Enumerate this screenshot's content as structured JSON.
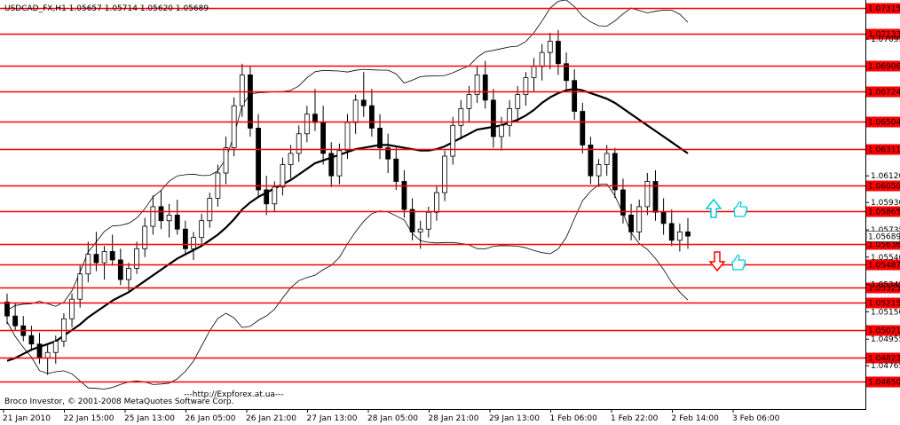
{
  "chart_data": {
    "type": "candlestick",
    "symbol_header": "USDCAD_FX,H1  1.05657 1.05714 1.05620 1.05689",
    "copyright": "Broco Investor, © 2001-2008 MetaQuotes Software Corp.",
    "watermark": "---http://Expforex.at.ua---",
    "ylim": [
      1.04545,
      1.0733
    ],
    "x_ticks": [
      "21 Jan 2010",
      "22 Jan 15:00",
      "25 Jan 13:00",
      "26 Jan 05:00",
      "26 Jan 21:00",
      "27 Jan 13:00",
      "28 Jan 05:00",
      "28 Jan 21:00",
      "29 Jan 13:00",
      "1 Feb 06:00",
      "1 Feb 22:00",
      "2 Feb 14:00",
      "3 Feb 06:00"
    ],
    "y_ticks": [
      "1.07095",
      "1.06120",
      "1.05930",
      "1.05735",
      "1.05540",
      "1.05345",
      "1.05150",
      "1.04955",
      "1.04765"
    ],
    "levels": [
      {
        "label": "1.07315",
        "value": 1.07315
      },
      {
        "label": "1.07133",
        "value": 1.07133
      },
      {
        "label": "1.06906",
        "value": 1.06906
      },
      {
        "label": "1.06724",
        "value": 1.06724
      },
      {
        "label": "1.06504",
        "value": 1.06504
      },
      {
        "label": "1.06311",
        "value": 1.06311
      },
      {
        "label": "1.06050",
        "value": 1.0605
      },
      {
        "label": "1.05865",
        "value": 1.05865
      },
      {
        "label": "1.05636",
        "value": 1.05636
      },
      {
        "label": "1.05487",
        "value": 1.05487
      },
      {
        "label": "1.05325",
        "value": 1.05325
      },
      {
        "label": "1.05215",
        "value": 1.05215
      },
      {
        "label": "1.05021",
        "value": 1.05021
      },
      {
        "label": "1.04823",
        "value": 1.04823
      },
      {
        "label": "1.04650",
        "value": 1.0465
      }
    ],
    "current_price": "1.05689",
    "colors": {
      "level_line": "#ff0000",
      "level_label_bg": "#ff0000",
      "level_label_text": "#ffffff",
      "candle": "#000000",
      "arrow_up": "#00ccdd",
      "arrow_down": "#ff0000",
      "hand_icon": "#00ccdd"
    },
    "signals": [
      {
        "type": "buy",
        "icon": "arrow-up",
        "hand": "thumbs-up-hand"
      },
      {
        "type": "sell",
        "icon": "arrow-down",
        "hand": "thumbs-up-hand"
      }
    ],
    "candles": [
      [
        1.0522,
        1.0528,
        1.0506,
        1.0512
      ],
      [
        1.0512,
        1.0521,
        1.0502,
        1.0505
      ],
      [
        1.0505,
        1.0512,
        1.0494,
        1.0498
      ],
      [
        1.0498,
        1.0505,
        1.0487,
        1.0492
      ],
      [
        1.0492,
        1.05,
        1.0478,
        1.0482
      ],
      [
        1.0482,
        1.0492,
        1.047,
        1.0486
      ],
      [
        1.0486,
        1.0498,
        1.0478,
        1.0494
      ],
      [
        1.0494,
        1.0514,
        1.049,
        1.051
      ],
      [
        1.051,
        1.0528,
        1.0504,
        1.0524
      ],
      [
        1.0524,
        1.0548,
        1.0518,
        1.0542
      ],
      [
        1.0542,
        1.0565,
        1.0536,
        1.0556
      ],
      [
        1.0556,
        1.0572,
        1.0544,
        1.055
      ],
      [
        1.055,
        1.0562,
        1.0538,
        1.0558
      ],
      [
        1.0558,
        1.057,
        1.0548,
        1.0552
      ],
      [
        1.0552,
        1.056,
        1.0534,
        1.0538
      ],
      [
        1.0538,
        1.055,
        1.053,
        1.0546
      ],
      [
        1.0546,
        1.0565,
        1.0542,
        1.056
      ],
      [
        1.056,
        1.0582,
        1.0554,
        1.0576
      ],
      [
        1.0576,
        1.0598,
        1.057,
        1.059
      ],
      [
        1.059,
        1.0602,
        1.0574,
        1.058
      ],
      [
        1.058,
        1.0592,
        1.0568,
        1.0584
      ],
      [
        1.0584,
        1.0595,
        1.057,
        1.0574
      ],
      [
        1.0574,
        1.058,
        1.0556,
        1.056
      ],
      [
        1.056,
        1.0572,
        1.0552,
        1.0568
      ],
      [
        1.0568,
        1.0585,
        1.0562,
        1.058
      ],
      [
        1.058,
        1.06,
        1.0575,
        1.0596
      ],
      [
        1.0596,
        1.062,
        1.059,
        1.0614
      ],
      [
        1.0614,
        1.064,
        1.0606,
        1.0632
      ],
      [
        1.0632,
        1.0668,
        1.0626,
        1.0662
      ],
      [
        1.0662,
        1.0692,
        1.0654,
        1.0684
      ],
      [
        1.0684,
        1.069,
        1.064,
        1.0646
      ],
      [
        1.0646,
        1.0656,
        1.0596,
        1.0602
      ],
      [
        1.0602,
        1.0612,
        1.0584,
        1.0592
      ],
      [
        1.0592,
        1.0608,
        1.0586,
        1.0604
      ],
      [
        1.0604,
        1.0625,
        1.0598,
        1.062
      ],
      [
        1.062,
        1.0634,
        1.061,
        1.0628
      ],
      [
        1.0628,
        1.0648,
        1.0622,
        1.0642
      ],
      [
        1.0642,
        1.0662,
        1.0636,
        1.0656
      ],
      [
        1.0656,
        1.0674,
        1.0644,
        1.065
      ],
      [
        1.065,
        1.0662,
        1.062,
        1.0628
      ],
      [
        1.0628,
        1.0636,
        1.0604,
        1.0612
      ],
      [
        1.0612,
        1.0635,
        1.0606,
        1.063
      ],
      [
        1.063,
        1.0656,
        1.0624,
        1.065
      ],
      [
        1.065,
        1.067,
        1.0642,
        1.0666
      ],
      [
        1.0666,
        1.0686,
        1.0654,
        1.0662
      ],
      [
        1.0662,
        1.0674,
        1.064,
        1.0646
      ],
      [
        1.0646,
        1.0656,
        1.0624,
        1.0632
      ],
      [
        1.0632,
        1.0642,
        1.0614,
        1.0624
      ],
      [
        1.0624,
        1.0632,
        1.0602,
        1.0608
      ],
      [
        1.0608,
        1.0616,
        1.0582,
        1.0588
      ],
      [
        1.0588,
        1.0596,
        1.0566,
        1.0572
      ],
      [
        1.0572,
        1.058,
        1.056,
        1.0574
      ],
      [
        1.0574,
        1.059,
        1.0568,
        1.0586
      ],
      [
        1.0586,
        1.0605,
        1.058,
        1.06
      ],
      [
        1.06,
        1.063,
        1.0594,
        1.0626
      ],
      [
        1.0626,
        1.0654,
        1.062,
        1.0648
      ],
      [
        1.0648,
        1.0666,
        1.0638,
        1.066
      ],
      [
        1.066,
        1.0676,
        1.065,
        1.067
      ],
      [
        1.067,
        1.069,
        1.0664,
        1.0684
      ],
      [
        1.0684,
        1.0694,
        1.066,
        1.0666
      ],
      [
        1.0666,
        1.0674,
        1.0632,
        1.064
      ],
      [
        1.064,
        1.0654,
        1.063,
        1.0648
      ],
      [
        1.0648,
        1.0666,
        1.064,
        1.066
      ],
      [
        1.066,
        1.0676,
        1.065,
        1.067
      ],
      [
        1.067,
        1.0686,
        1.0662,
        1.0682
      ],
      [
        1.0682,
        1.0696,
        1.0672,
        1.069
      ],
      [
        1.069,
        1.0706,
        1.068,
        1.07
      ],
      [
        1.07,
        1.0714,
        1.0688,
        1.0708
      ],
      [
        1.0708,
        1.0716,
        1.0684,
        1.0692
      ],
      [
        1.0692,
        1.07,
        1.0672,
        1.068
      ],
      [
        1.068,
        1.0688,
        1.0652,
        1.0658
      ],
      [
        1.0658,
        1.0664,
        1.0628,
        1.0634
      ],
      [
        1.0634,
        1.064,
        1.0606,
        1.0612
      ],
      [
        1.0612,
        1.0624,
        1.0604,
        1.062
      ],
      [
        1.062,
        1.0634,
        1.0612,
        1.0628
      ],
      [
        1.0628,
        1.0632,
        1.0596,
        1.0602
      ],
      [
        1.0602,
        1.061,
        1.0578,
        1.0584
      ],
      [
        1.0584,
        1.0592,
        1.0566,
        1.0572
      ],
      [
        1.0572,
        1.0595,
        1.0566,
        1.059
      ],
      [
        1.059,
        1.0614,
        1.0584,
        1.0608
      ],
      [
        1.0608,
        1.0616,
        1.058,
        1.0586
      ],
      [
        1.0586,
        1.0596,
        1.057,
        1.0578
      ],
      [
        1.0578,
        1.0588,
        1.0562,
        1.0566
      ],
      [
        1.0566,
        1.0578,
        1.0558,
        1.0572
      ],
      [
        1.0572,
        1.0582,
        1.056,
        1.0569
      ]
    ],
    "sma": [
      1.048,
      1.0482,
      1.0485,
      1.0488,
      1.049,
      1.0492,
      1.0494,
      1.0498,
      1.0502,
      1.0506,
      1.0511,
      1.0515,
      1.0519,
      1.0523,
      1.0526,
      1.0529,
      1.0533,
      1.0537,
      1.0541,
      1.0545,
      1.0549,
      1.0553,
      1.0556,
      1.0559,
      1.0562,
      1.0566,
      1.057,
      1.0575,
      1.0581,
      1.0588,
      1.0593,
      1.0597,
      1.06,
      1.0603,
      1.0606,
      1.0609,
      1.0613,
      1.0617,
      1.0621,
      1.0623,
      1.0625,
      1.0627,
      1.0629,
      1.0631,
      1.0632,
      1.0633,
      1.0634,
      1.0634,
      1.0633,
      1.0632,
      1.0631,
      1.063,
      1.063,
      1.0631,
      1.0633,
      1.0636,
      1.0639,
      1.0642,
      1.0645,
      1.0646,
      1.0647,
      1.0648,
      1.065,
      1.0652,
      1.0655,
      1.0659,
      1.0664,
      1.0668,
      1.0671,
      1.0673,
      1.0674,
      1.0673,
      1.0671,
      1.0669,
      1.0667,
      1.0664,
      1.066,
      1.0656,
      1.0652,
      1.0648,
      1.0644,
      1.064,
      1.0636,
      1.0632,
      1.0628
    ]
  }
}
